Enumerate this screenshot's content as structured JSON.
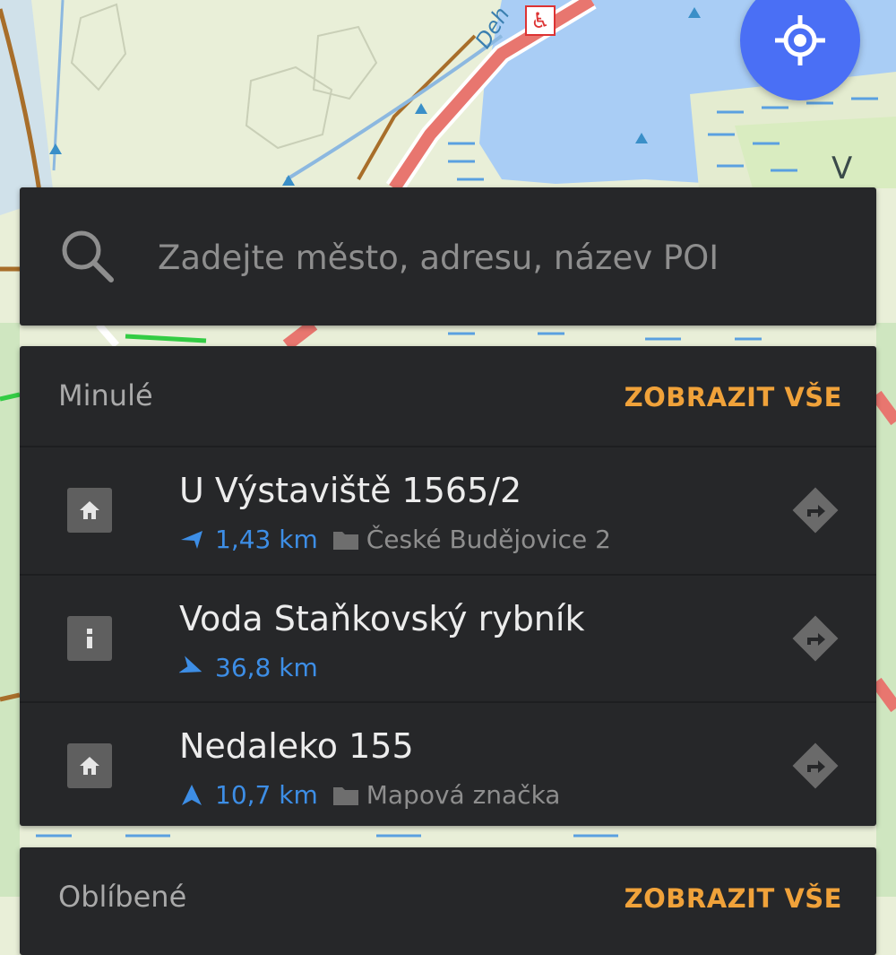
{
  "map": {
    "street_label": "Deh",
    "place_label": "V Ry"
  },
  "search": {
    "placeholder": "Zadejte město, adresu, název POI"
  },
  "recent": {
    "title": "Minulé",
    "show_all": "ZOBRAZIT VŠE",
    "items": [
      {
        "name": "U Výstaviště 1565/2",
        "icon": "home-icon",
        "distance": "1,43 km",
        "direction": "left",
        "category": "České Budějovice 2"
      },
      {
        "name": "Voda Staňkovský rybník",
        "icon": "info-icon",
        "distance": "36,8 km",
        "direction": "down-right",
        "category": ""
      },
      {
        "name": "Nedaleko 155",
        "icon": "home-icon",
        "distance": "10,7 km",
        "direction": "up",
        "category": "Mapová značka"
      }
    ]
  },
  "favorites": {
    "title": "Oblíbené",
    "show_all": "ZOBRAZIT VŠE"
  },
  "colors": {
    "panel": "#262729",
    "accent_orange": "#f0a23a",
    "distance_blue": "#3d8ee6",
    "locate_button": "#4a6ff5",
    "water": "#a9cdf5",
    "road_red": "#e8766f"
  }
}
